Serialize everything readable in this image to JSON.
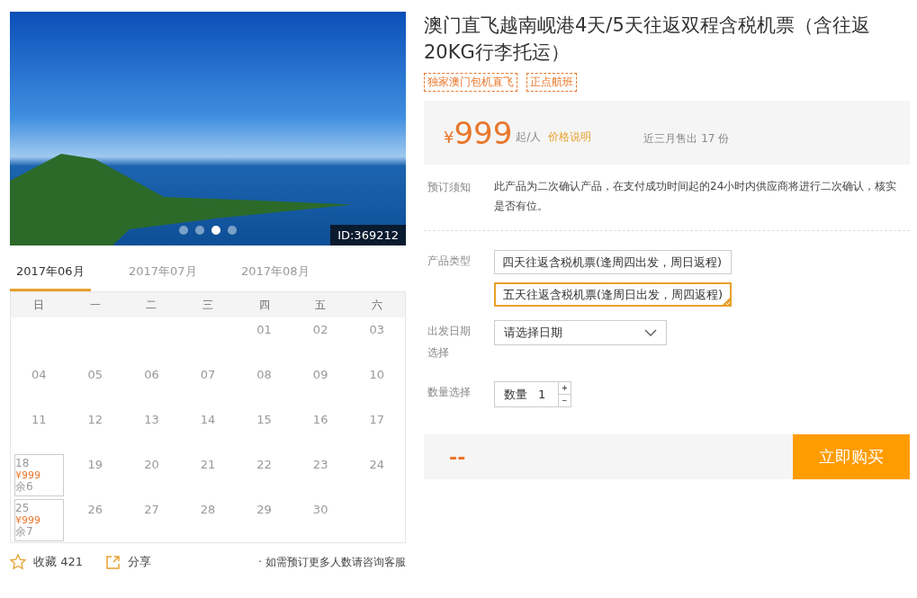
{
  "gallery": {
    "id_badge": "ID:369212",
    "dots": [
      {
        "selected": false
      },
      {
        "selected": false
      },
      {
        "selected": true
      },
      {
        "selected": false
      }
    ]
  },
  "calendar": {
    "months": [
      {
        "label": "2017年06月",
        "selected": true
      },
      {
        "label": "2017年07月",
        "selected": false
      },
      {
        "label": "2017年08月",
        "selected": false
      }
    ],
    "weekdays": [
      "日",
      "一",
      "二",
      "三",
      "四",
      "五",
      "六"
    ],
    "weeks": [
      [
        {
          "kind": "blank"
        },
        {
          "kind": "blank"
        },
        {
          "kind": "blank"
        },
        {
          "kind": "blank"
        },
        {
          "kind": "day",
          "day": "01"
        },
        {
          "kind": "day",
          "day": "02"
        },
        {
          "kind": "day",
          "day": "03"
        }
      ],
      [
        {
          "kind": "day",
          "day": "04"
        },
        {
          "kind": "day",
          "day": "05"
        },
        {
          "kind": "day",
          "day": "06"
        },
        {
          "kind": "day",
          "day": "07"
        },
        {
          "kind": "day",
          "day": "08"
        },
        {
          "kind": "day",
          "day": "09"
        },
        {
          "kind": "day",
          "day": "10"
        }
      ],
      [
        {
          "kind": "day",
          "day": "11"
        },
        {
          "kind": "day",
          "day": "12"
        },
        {
          "kind": "day",
          "day": "13"
        },
        {
          "kind": "day",
          "day": "14"
        },
        {
          "kind": "day",
          "day": "15"
        },
        {
          "kind": "day",
          "day": "16"
        },
        {
          "kind": "day",
          "day": "17"
        }
      ],
      [
        {
          "kind": "available",
          "day": "18",
          "price": "¥999",
          "stock": "余6"
        },
        {
          "kind": "day",
          "day": "19"
        },
        {
          "kind": "day",
          "day": "20"
        },
        {
          "kind": "day",
          "day": "21"
        },
        {
          "kind": "day",
          "day": "22"
        },
        {
          "kind": "day",
          "day": "23"
        },
        {
          "kind": "day",
          "day": "24"
        }
      ],
      [
        {
          "kind": "available",
          "day": "25",
          "price": "¥999",
          "stock": "余7"
        },
        {
          "kind": "day",
          "day": "26"
        },
        {
          "kind": "day",
          "day": "27"
        },
        {
          "kind": "day",
          "day": "28"
        },
        {
          "kind": "day",
          "day": "29"
        },
        {
          "kind": "day",
          "day": "30"
        },
        {
          "kind": "blank"
        }
      ]
    ]
  },
  "actions": {
    "favorite": "收藏 421",
    "share": "分享",
    "note": "· 如需预订更多人数请咨询客服"
  },
  "product": {
    "title": "澳门直飞越南岘港4天/5天往返双程含税机票（含往返20KG行李托运）",
    "tags": [
      "独家澳门包机直飞",
      "正点航班"
    ],
    "price": {
      "currency": "¥",
      "amount": "999",
      "unit": "起/人",
      "link": "价格说明",
      "sales": "近三月售出 17 份"
    },
    "notice": {
      "label": "预订须知",
      "text": "此产品为二次确认产品，在支付成功时间起的24小时内供应商将进行二次确认，核实是否有位。"
    },
    "type": {
      "label": "产品类型",
      "options": [
        {
          "label": "四天往返含税机票(逢周四出发，周日返程)",
          "selected": false
        },
        {
          "label": "五天往返含税机票(逢周日出发，周四返程)",
          "selected": true
        }
      ]
    },
    "date": {
      "label": "出发日期选择",
      "value": "请选择日期"
    },
    "quantity": {
      "label": "数量选择",
      "prefix": "数量",
      "value": "1",
      "plus": "+",
      "minus": "−"
    },
    "total": "--",
    "buy": "立即购买"
  }
}
